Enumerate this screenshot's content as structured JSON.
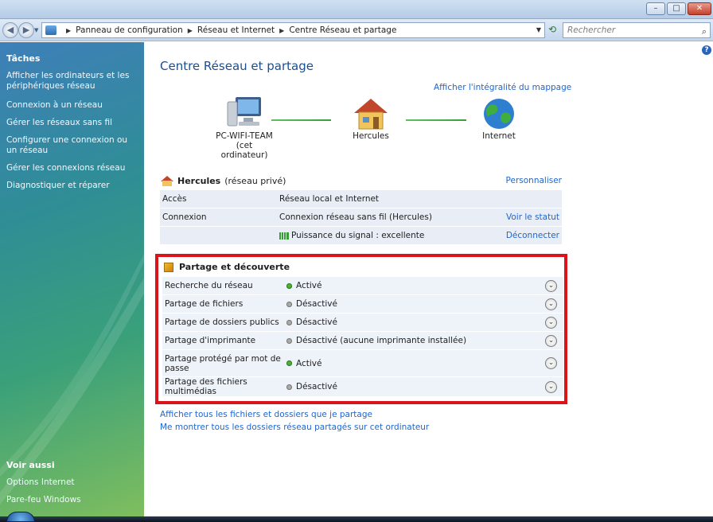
{
  "address": {
    "crumbs": [
      "Panneau de configuration",
      "Réseau et Internet",
      "Centre Réseau et partage"
    ],
    "search_placeholder": "Rechercher"
  },
  "sidebar": {
    "tasks_heading": "Tâches",
    "tasks": [
      "Afficher les ordinateurs et les périphériques réseau",
      "Connexion à un réseau",
      "Gérer les réseaux sans fil",
      "Configurer une connexion ou un réseau",
      "Gérer les connexions réseau",
      "Diagnostiquer et réparer"
    ],
    "see_also_heading": "Voir aussi",
    "see_also": [
      "Options Internet",
      "Pare-feu Windows"
    ]
  },
  "main": {
    "title": "Centre Réseau et partage",
    "map_link": "Afficher l'intégralité du mappage",
    "map": {
      "computer_name": "PC-WIFI-TEAM",
      "computer_note": "(cet ordinateur)",
      "network_name": "Hercules",
      "internet": "Internet"
    },
    "network": {
      "name": "Hercules",
      "type": "(réseau privé)",
      "customize": "Personnaliser",
      "rows": [
        {
          "key": "Accès",
          "value": "Réseau local et Internet",
          "action": ""
        },
        {
          "key": "Connexion",
          "value": "Connexion réseau sans fil (Hercules)",
          "action": "Voir le statut"
        },
        {
          "key": "",
          "value": "Puissance du signal : excellente",
          "action": "Déconnecter"
        }
      ]
    },
    "sharing": {
      "heading": "Partage et découverte",
      "rows": [
        {
          "key": "Recherche du réseau",
          "value": "Activé",
          "state": "on"
        },
        {
          "key": "Partage de fichiers",
          "value": "Désactivé",
          "state": "off"
        },
        {
          "key": "Partage de dossiers publics",
          "value": "Désactivé",
          "state": "off"
        },
        {
          "key": "Partage d'imprimante",
          "value": "Désactivé (aucune imprimante installée)",
          "state": "off"
        },
        {
          "key": "Partage protégé par mot de passe",
          "value": "Activé",
          "state": "on"
        },
        {
          "key": "Partage des fichiers multimédias",
          "value": "Désactivé",
          "state": "off"
        }
      ]
    },
    "bottom_links": [
      "Afficher tous les fichiers et dossiers que je partage",
      "Me montrer tous les dossiers réseau partagés sur cet ordinateur"
    ]
  },
  "colors": {
    "link": "#2266cc",
    "title": "#1c4f8f",
    "highlight_border": "#d9141b"
  }
}
